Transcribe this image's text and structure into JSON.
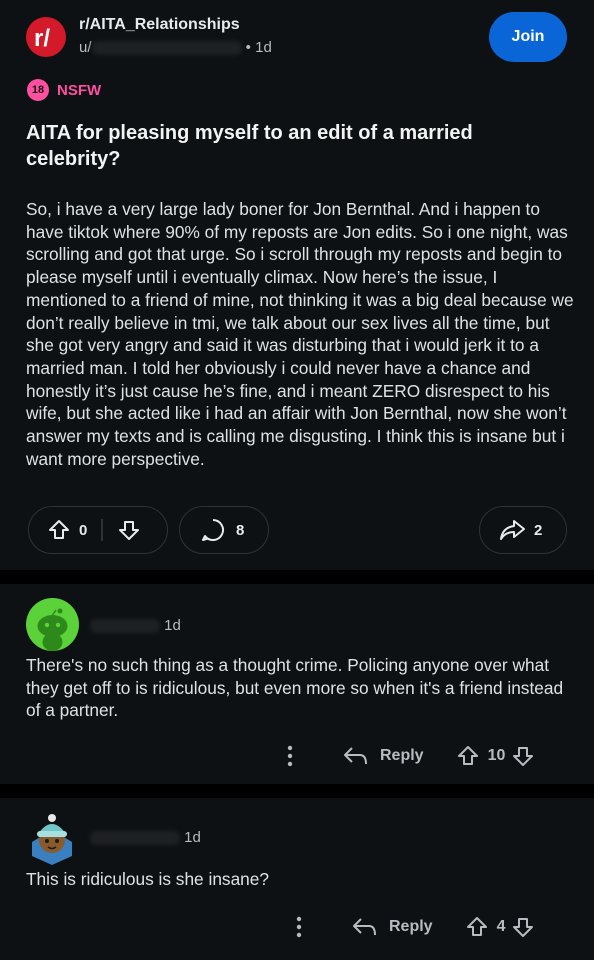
{
  "post": {
    "subreddit": "r/AITA_Relationships",
    "author_prefix": "u/",
    "age": "1d",
    "join_label": "Join",
    "nsfw_badge": "18",
    "nsfw_label": "NSFW",
    "title": "AITA for pleasing myself to an edit of a married celebrity?",
    "body": "So, i have a very large lady boner for Jon Bernthal. And i happen to have tiktok where 90% of my reposts are Jon edits. So i one night, was scrolling and got that urge. So i scroll through my reposts and begin to please myself until i eventually climax. Now here’s the issue, I mentioned to a friend of mine, not thinking it was a big deal because we don’t really believe in tmi, we talk about our sex lives all the time, but she got very angry and said it was disturbing that i would jerk it to a married man. I told her obviously i could never have a chance and honestly it’s just cause he’s fine, and i meant ZERO disrespect to his wife, but she acted like i had an affair with Jon Bernthal, now she won’t answer my texts and is calling me disgusting. I think this is insane but i want more perspective.",
    "votes": "0",
    "comments": "8",
    "shares": "2"
  },
  "comments": [
    {
      "age": "1d",
      "text": "There's no such thing as a thought crime. Policing anyone over what they get off to is ridiculous, but even more so when it's a friend instead of a partner.",
      "reply_label": "Reply",
      "votes": "10"
    },
    {
      "age": "1d",
      "text": "This is ridiculous is she insane?",
      "reply_label": "Reply",
      "votes": "4"
    }
  ],
  "colors": {
    "background": "#0e1113",
    "accent": "#0a65d6",
    "nsfw": "#ff4fa0",
    "subreddit_icon": "#d21a2a"
  }
}
